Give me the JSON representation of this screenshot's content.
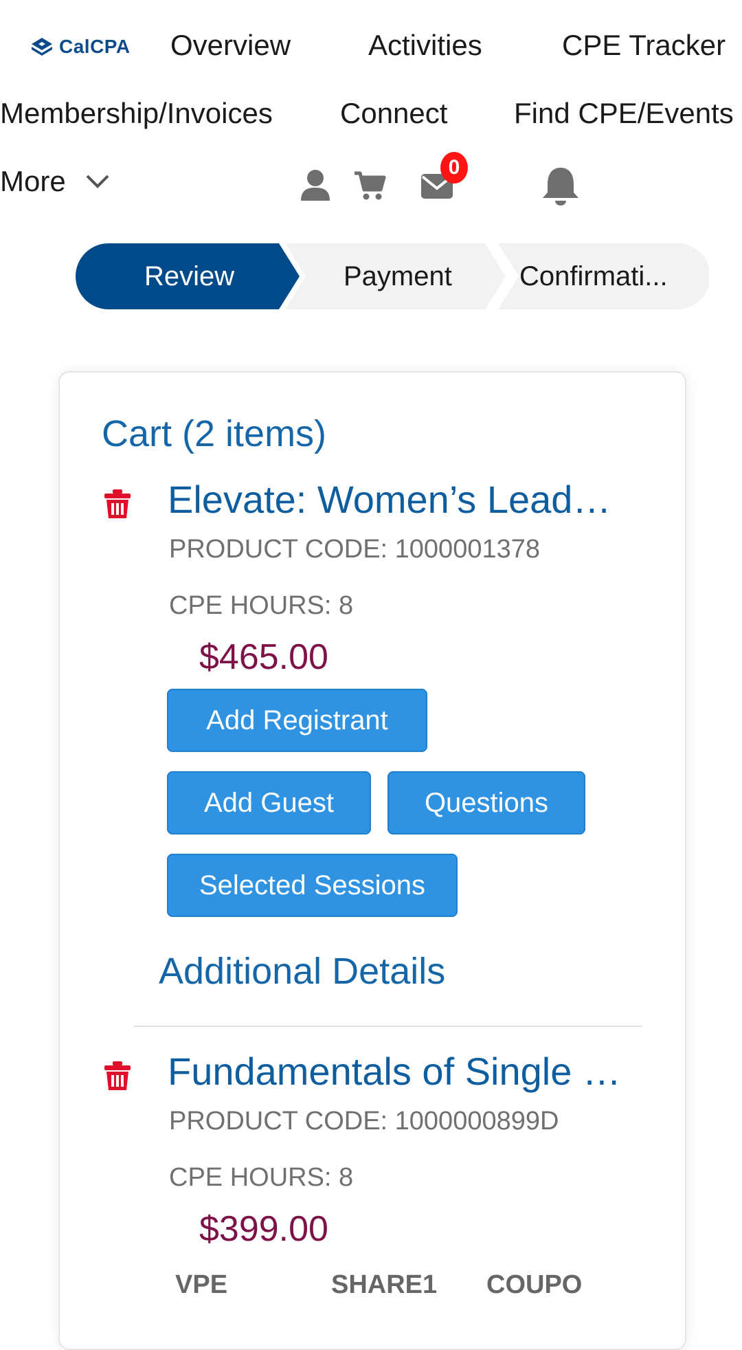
{
  "nav": {
    "logo_text": "CalCPA",
    "links": [
      "Overview",
      "Activities",
      "CPE Tracker",
      "Membership/Invoices",
      "Connect",
      "Find CPE/Events"
    ],
    "more_label": "More",
    "mail_badge": "0"
  },
  "stepper": {
    "steps": [
      "Review",
      "Payment",
      "Confirmati..."
    ],
    "active_color": "#004a89"
  },
  "cart": {
    "title": "Cart (2 items)",
    "items": [
      {
        "title": "Elevate: Women’s Lead…",
        "product_code": "PRODUCT CODE: 1000001378",
        "cpe_hours": "CPE HOURS: 8",
        "price": "$465.00",
        "buttons": [
          "Add Registrant",
          "Add Guest",
          "Questions",
          "Selected Sessions"
        ],
        "details_label": "Additional Details"
      },
      {
        "title": "Fundamentals of Single …",
        "product_code": "PRODUCT CODE: 1000000899D",
        "cpe_hours": "CPE HOURS: 8",
        "price": "$399.00",
        "labels": [
          "VPE",
          "SHARE1",
          "COUPO"
        ]
      }
    ]
  },
  "colors": {
    "link_blue": "#0e5e9f",
    "button_blue": "#2f93e2",
    "price": "#7d1248",
    "delete_red": "#e0102a"
  }
}
